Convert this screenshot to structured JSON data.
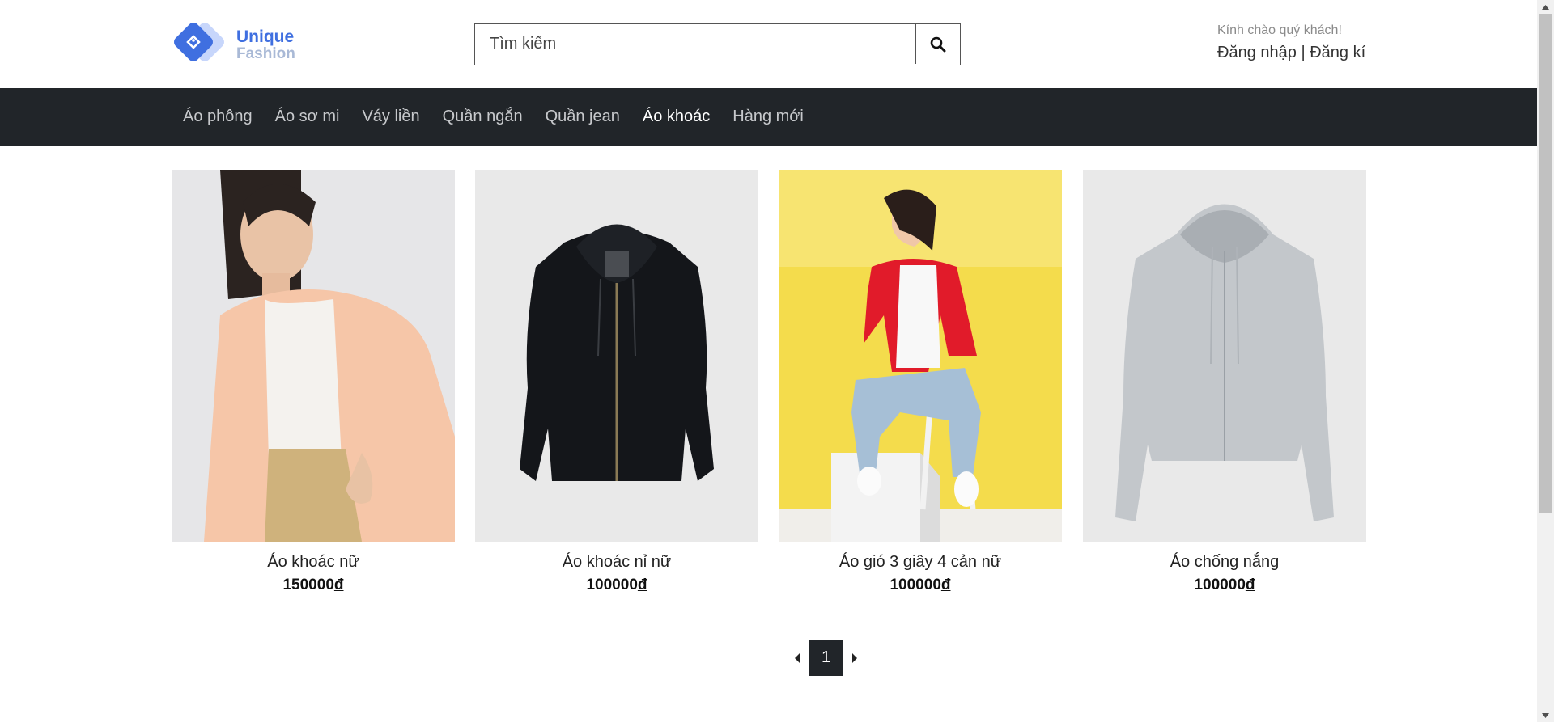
{
  "brand": {
    "line1": "Unique",
    "line2": "Fashion",
    "accent": "#3f6fe0"
  },
  "search": {
    "placeholder": "Tìm kiếm",
    "value": ""
  },
  "account": {
    "greeting": "Kính chào quý khách!",
    "login": "Đăng nhập",
    "separator": "|",
    "register": "Đăng kí"
  },
  "nav": {
    "items": [
      {
        "label": "Áo phông"
      },
      {
        "label": "Áo sơ mi"
      },
      {
        "label": "Váy liền"
      },
      {
        "label": "Quần ngắn"
      },
      {
        "label": "Quần jean"
      },
      {
        "label": "Áo khoác"
      },
      {
        "label": "Hàng mới"
      }
    ],
    "active": "Áo khoác"
  },
  "products": [
    {
      "name": "Áo khoác nữ",
      "price": "150000",
      "currency": "đ",
      "image": "woman-peach-cardigan"
    },
    {
      "name": "Áo khoác nỉ nữ",
      "price": "100000",
      "currency": "đ",
      "image": "black-zip-hoodie"
    },
    {
      "name": "Áo gió 3 giây 4 cản nữ",
      "price": "100000",
      "currency": "đ",
      "image": "woman-red-windbreaker"
    },
    {
      "name": "Áo chống nắng",
      "price": "100000",
      "currency": "đ",
      "image": "grey-sun-protection-hoodie"
    }
  ],
  "pagination": {
    "current": "1"
  },
  "colors": {
    "nav_bg": "#212529",
    "page_active_bg": "#212529"
  }
}
